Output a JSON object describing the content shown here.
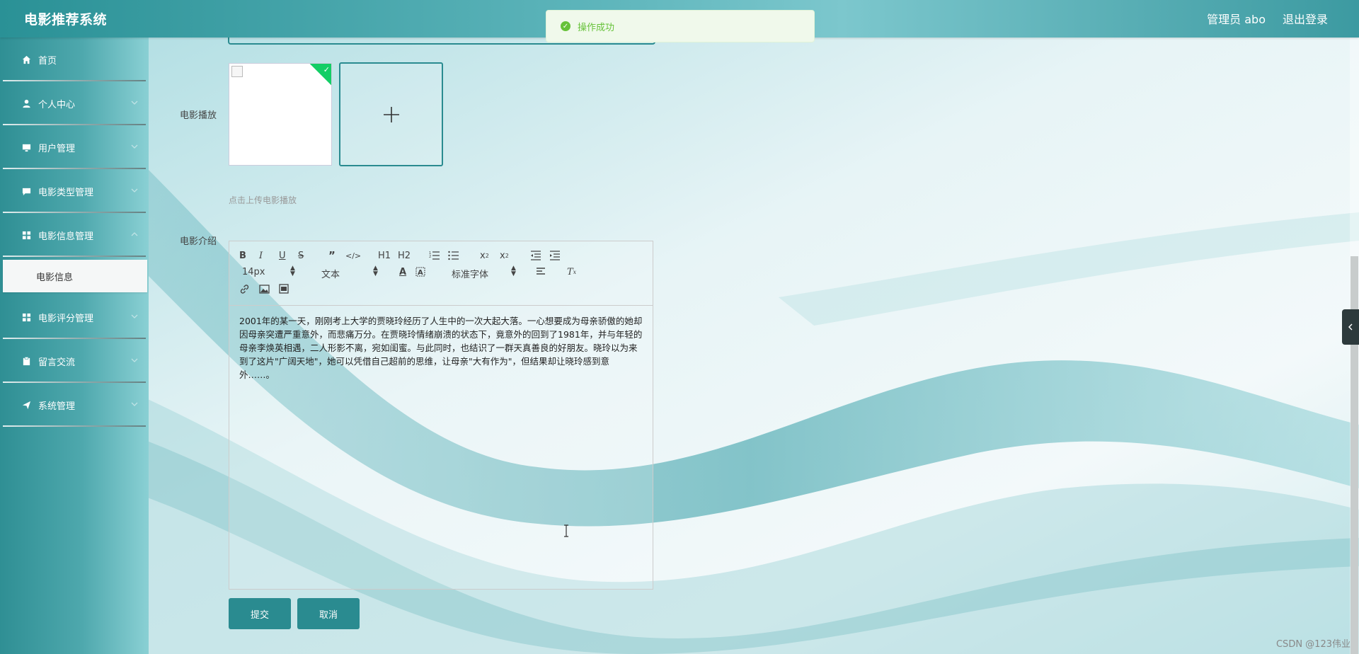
{
  "header": {
    "app_title": "电影推荐系统",
    "user_label": "管理员 abo",
    "logout_label": "退出登录"
  },
  "toast": {
    "message": "操作成功"
  },
  "sidebar": {
    "items": [
      {
        "label": "首页",
        "icon": "home-icon"
      },
      {
        "label": "个人中心",
        "icon": "user-icon"
      },
      {
        "label": "用户管理",
        "icon": "monitor-icon"
      },
      {
        "label": "电影类型管理",
        "icon": "chat-icon"
      },
      {
        "label": "电影信息管理",
        "icon": "grid-icon"
      },
      {
        "label": "电影评分管理",
        "icon": "grid-icon"
      },
      {
        "label": "留言交流",
        "icon": "clipboard-icon"
      },
      {
        "label": "系统管理",
        "icon": "send-icon"
      }
    ],
    "active_sub": "电影信息"
  },
  "form": {
    "play_label": "电影播放",
    "upload_hint": "点击上传电影播放",
    "intro_label": "电影介绍",
    "intro_text": "2001年的某一天，刚刚考上大学的贾晓玲经历了人生中的一次大起大落。一心想要成为母亲骄傲的她却因母亲突遭严重意外，而悲痛万分。在贾晓玲情绪崩溃的状态下，竟意外的回到了1981年，并与年轻的母亲李焕英相遇，二人形影不离，宛如闺蜜。与此同时，也结识了一群天真善良的好朋友。晓玲以为来到了这片\"广阔天地\"，她可以凭借自己超前的思维，让母亲\"大有作为\"，但结果却让晓玲感到意外……。",
    "submit_label": "提交",
    "cancel_label": "取消"
  },
  "editor_toolbar": {
    "font_size": "14px",
    "header_select": "文本",
    "font_family": "标准字体",
    "h1": "H1",
    "h2": "H2"
  },
  "watermark": "CSDN @123伟业",
  "colors": {
    "accent": "#2a8b90",
    "toast_bg": "#f0f9eb",
    "toast_text": "#67c23a"
  }
}
